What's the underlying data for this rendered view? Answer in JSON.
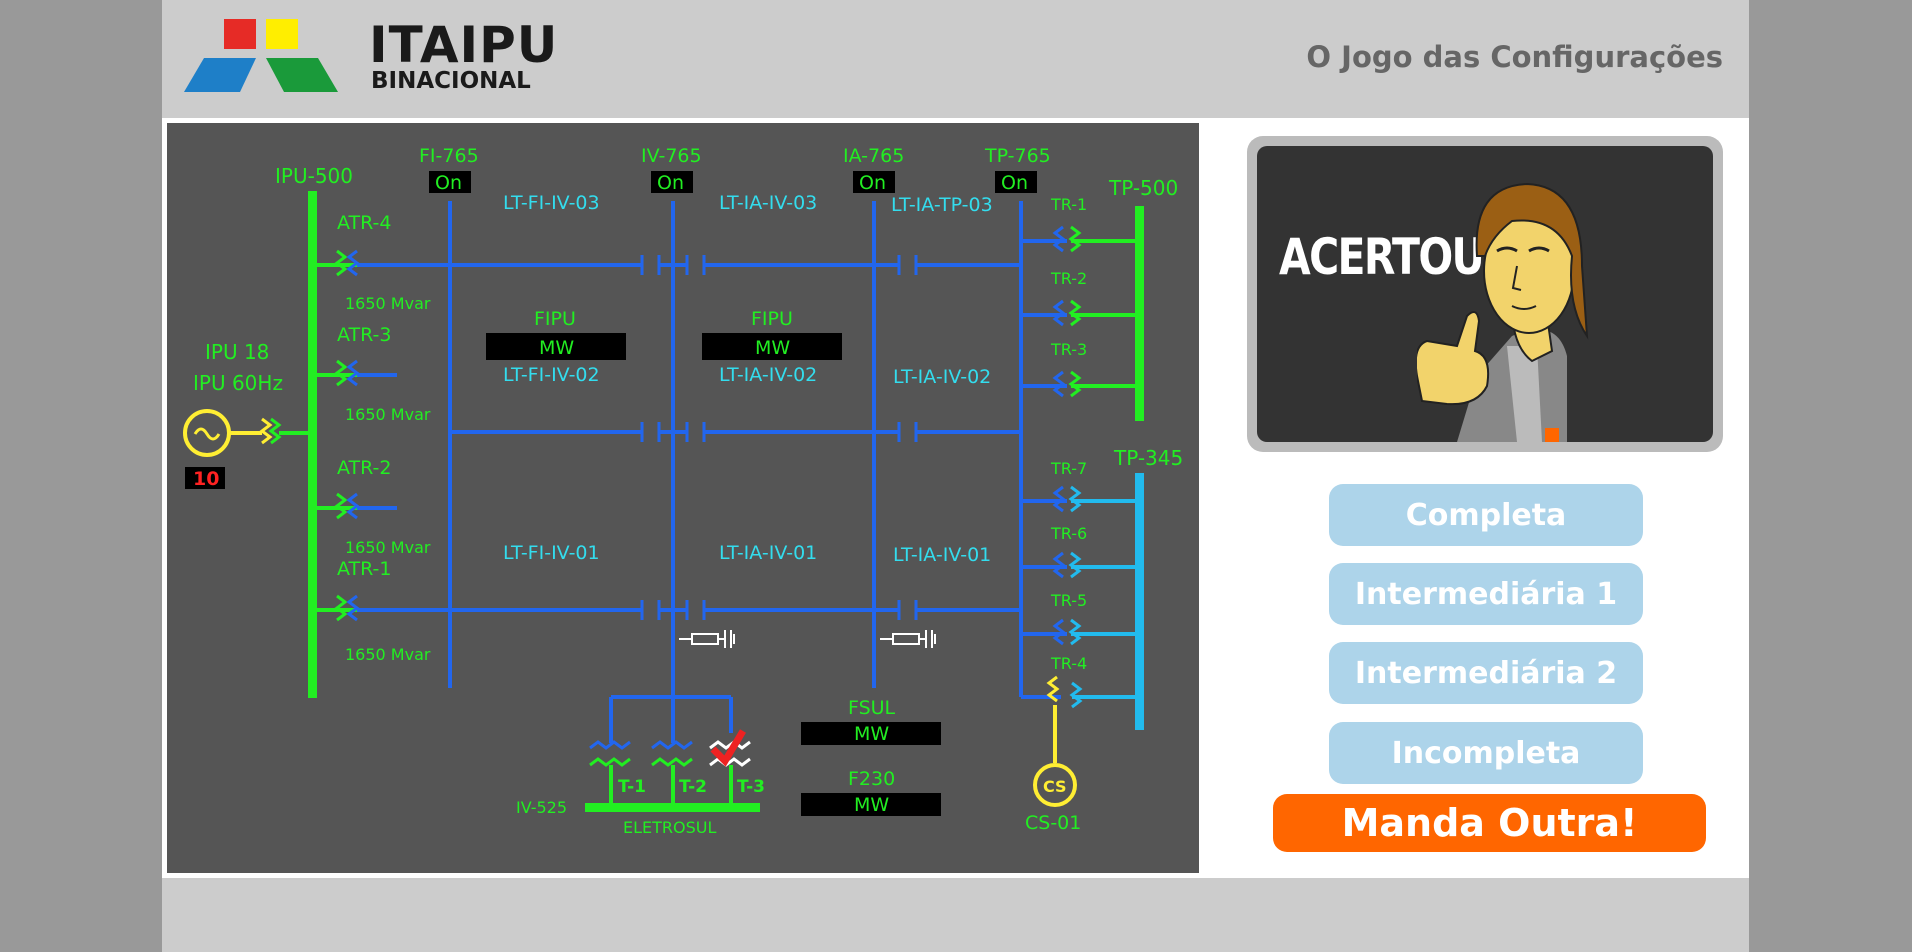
{
  "header": {
    "logo_title": "ITAIPU",
    "logo_subtitle": "BINACIONAL",
    "game_title": "O Jogo das Configurações"
  },
  "diagram": {
    "generator": {
      "label1": "IPU 18",
      "label2": "IPU 60Hz",
      "value": "10"
    },
    "buses": {
      "ipu500": "IPU-500",
      "tp500": "TP-500",
      "tp345": "TP-345",
      "iv525": "IV-525",
      "eletrosul": "ELETROSUL"
    },
    "switches": [
      {
        "name": "FI-765",
        "state": "On"
      },
      {
        "name": "IV-765",
        "state": "On"
      },
      {
        "name": "IA-765",
        "state": "On"
      },
      {
        "name": "TP-765",
        "state": "On"
      }
    ],
    "atr": [
      {
        "name": "ATR-4",
        "mvar": "1650 Mvar"
      },
      {
        "name": "ATR-3",
        "mvar": "1650 Mvar"
      },
      {
        "name": "ATR-2",
        "mvar": "1650 Mvar"
      },
      {
        "name": "ATR-1",
        "mvar": "1650 Mvar"
      }
    ],
    "lines": {
      "fi_iv_03": "LT-FI-IV-03",
      "ia_iv_03": "LT-IA-IV-03",
      "ia_tp_03": "LT-IA-TP-03",
      "fi_iv_02": "LT-FI-IV-02",
      "ia_iv_02a": "LT-IA-IV-02",
      "ia_iv_02b": "LT-IA-IV-02",
      "fi_iv_01": "LT-FI-IV-01",
      "ia_iv_01a": "LT-IA-IV-01",
      "ia_iv_01b": "LT-IA-IV-01"
    },
    "meters": [
      {
        "name": "FIPU",
        "unit": "MW"
      },
      {
        "name": "FIPU",
        "unit": "MW"
      },
      {
        "name": "FSUL",
        "unit": "MW"
      },
      {
        "name": "F230",
        "unit": "MW"
      }
    ],
    "transformers_tp": [
      "TR-1",
      "TR-2",
      "TR-3",
      "TR-7",
      "TR-6",
      "TR-5",
      "TR-4"
    ],
    "transformers_iv": [
      "T-1",
      "T-2",
      "T-3"
    ],
    "compensator": {
      "symbol": "CS",
      "name": "CS-01"
    }
  },
  "result": {
    "message": "ACERTOU !!!"
  },
  "menu": {
    "completa": "Completa",
    "intermediaria1": "Intermediária 1",
    "intermediaria2": "Intermediária 2",
    "incompleta": "Incompleta",
    "manda_outra": "Manda Outra!"
  },
  "colors": {
    "bus_green": "#22ee22",
    "line_blue": "#2266ee",
    "bus_cyan": "#22bbee",
    "generator_yellow": "#ffee33",
    "button_light_blue": "#add4ea",
    "button_orange": "#ff6600",
    "diagram_bg": "#555555"
  }
}
